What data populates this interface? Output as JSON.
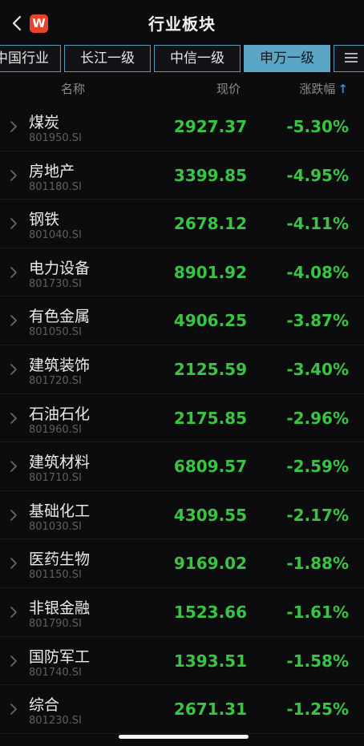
{
  "header": {
    "title": "行业板块",
    "logo_text": "W"
  },
  "tabs": [
    {
      "label": "中国行业",
      "active": false
    },
    {
      "label": "长江一级",
      "active": false
    },
    {
      "label": "中信一级",
      "active": false
    },
    {
      "label": "申万一级",
      "active": true
    }
  ],
  "columns": {
    "name": "名称",
    "price": "现价",
    "change": "涨跌幅",
    "sort_arrow": "↑"
  },
  "colors": {
    "down_green": "#39c443",
    "accent_blue": "#2f8de4",
    "active_tab": "#5aa6c4",
    "logo_red": "#e8432c"
  },
  "rows": [
    {
      "name": "煤炭",
      "code": "801950.SI",
      "price": "2927.37",
      "change": "-5.30%"
    },
    {
      "name": "房地产",
      "code": "801180.SI",
      "price": "3399.85",
      "change": "-4.95%"
    },
    {
      "name": "钢铁",
      "code": "801040.SI",
      "price": "2678.12",
      "change": "-4.11%"
    },
    {
      "name": "电力设备",
      "code": "801730.SI",
      "price": "8901.92",
      "change": "-4.08%"
    },
    {
      "name": "有色金属",
      "code": "801050.SI",
      "price": "4906.25",
      "change": "-3.87%"
    },
    {
      "name": "建筑装饰",
      "code": "801720.SI",
      "price": "2125.59",
      "change": "-3.40%"
    },
    {
      "name": "石油石化",
      "code": "801960.SI",
      "price": "2175.85",
      "change": "-2.96%"
    },
    {
      "name": "建筑材料",
      "code": "801710.SI",
      "price": "6809.57",
      "change": "-2.59%"
    },
    {
      "name": "基础化工",
      "code": "801030.SI",
      "price": "4309.55",
      "change": "-2.17%"
    },
    {
      "name": "医药生物",
      "code": "801150.SI",
      "price": "9169.02",
      "change": "-1.88%"
    },
    {
      "name": "非银金融",
      "code": "801790.SI",
      "price": "1523.66",
      "change": "-1.61%"
    },
    {
      "name": "国防军工",
      "code": "801740.SI",
      "price": "1393.51",
      "change": "-1.58%"
    },
    {
      "name": "综合",
      "code": "801230.SI",
      "price": "2671.31",
      "change": "-1.25%"
    }
  ]
}
